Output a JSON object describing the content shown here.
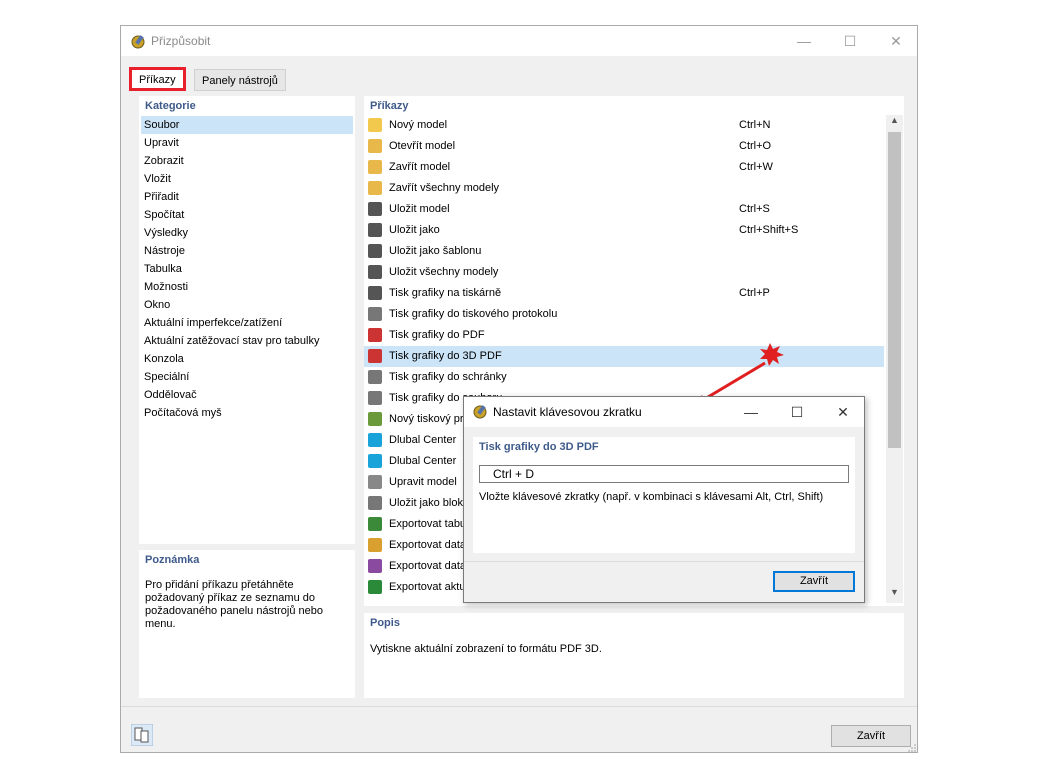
{
  "window": {
    "title": "Přizpůsobit",
    "min": "—",
    "max": "☐",
    "close": "✕"
  },
  "tabs": [
    {
      "label": "Příkazy"
    },
    {
      "label": "Panely nástrojů"
    }
  ],
  "categories": {
    "header": "Kategorie",
    "items": [
      {
        "label": "Soubor"
      },
      {
        "label": "Upravit"
      },
      {
        "label": "Zobrazit"
      },
      {
        "label": "Vložit"
      },
      {
        "label": "Přiřadit"
      },
      {
        "label": "Spočítat"
      },
      {
        "label": "Výsledky"
      },
      {
        "label": "Nástroje"
      },
      {
        "label": "Tabulka"
      },
      {
        "label": "Možnosti"
      },
      {
        "label": "Okno"
      },
      {
        "label": "Aktuální imperfekce/zatížení"
      },
      {
        "label": "Aktuální zatěžovací stav pro tabulky"
      },
      {
        "label": "Konzola"
      },
      {
        "label": "Speciální"
      },
      {
        "label": "Oddělovač"
      },
      {
        "label": "Počítačová myš"
      }
    ]
  },
  "note": {
    "header": "Poznámka",
    "text": "Pro přidání příkazu přetáhněte požadovaný příkaz ze seznamu do požadovaného panelu nástrojů nebo menu."
  },
  "commands": {
    "header": "Příkazy",
    "items": [
      {
        "label": "Nový model",
        "key": "Ctrl+N",
        "icon": "new-model-icon"
      },
      {
        "label": "Otevřít model",
        "key": "Ctrl+O",
        "icon": "open-folder-icon"
      },
      {
        "label": "Zavřít model",
        "key": "Ctrl+W",
        "icon": "close-folder-icon"
      },
      {
        "label": "Zavřít všechny modely",
        "key": "",
        "icon": "close-all-folders-icon"
      },
      {
        "label": "Uložit model",
        "key": "Ctrl+S",
        "icon": "save-icon"
      },
      {
        "label": "Uložit jako",
        "key": "Ctrl+Shift+S",
        "icon": "save-as-icon"
      },
      {
        "label": "Uložit jako šablonu",
        "key": "",
        "icon": "save-template-icon"
      },
      {
        "label": "Uložit všechny modely",
        "key": "",
        "icon": "save-all-icon"
      },
      {
        "label": "Tisk grafiky na tiskárně",
        "key": "Ctrl+P",
        "icon": "printer-icon"
      },
      {
        "label": "Tisk grafiky do tiskového protokolu",
        "key": "",
        "icon": "print-report-icon"
      },
      {
        "label": "Tisk grafiky do PDF",
        "key": "",
        "icon": "print-pdf-icon"
      },
      {
        "label": "Tisk grafiky do 3D PDF",
        "key": "",
        "icon": "print-3d-pdf-icon"
      },
      {
        "label": "Tisk grafiky do schránky",
        "key": "",
        "icon": "print-clipboard-icon"
      },
      {
        "label": "Tisk grafiky do souboru",
        "key": "",
        "icon": "print-file-icon"
      },
      {
        "label": "Nový tiskový protokol",
        "key": "",
        "icon": "new-report-icon"
      },
      {
        "label": "Dlubal Center",
        "key": "",
        "icon": "dlubal-center-icon"
      },
      {
        "label": "Dlubal Center",
        "key": "",
        "icon": "dlubal-center-settings-icon"
      },
      {
        "label": "Upravit model",
        "key": "",
        "icon": "edit-model-icon"
      },
      {
        "label": "Uložit jako blok",
        "key": "",
        "icon": "save-block-icon"
      },
      {
        "label": "Exportovat tabulky",
        "key": "",
        "icon": "export-table-icon"
      },
      {
        "label": "Exportovat data",
        "key": "",
        "icon": "export-data-icon"
      },
      {
        "label": "Exportovat data",
        "key": "",
        "icon": "export-data-2-icon"
      },
      {
        "label": "Exportovat aktuální",
        "key": "",
        "icon": "export-sap-icon"
      }
    ]
  },
  "description": {
    "header": "Popis",
    "text": "Vytiskne aktuální zobrazení to formátu PDF 3D."
  },
  "footer": {
    "close_label": "Zavřít"
  },
  "shortcut_dialog": {
    "title": "Nastavit klávesovou zkratku",
    "command": "Tisk grafiky do 3D PDF",
    "input_value": "Ctrl + D",
    "hint": "Vložte klávesové zkratky (např. v kombinaci s klávesami Alt, Ctrl, Shift)",
    "close_label": "Zavřít",
    "min": "—",
    "max": "☐",
    "close": "✕"
  },
  "colors": {
    "highlight": "#cce4f7",
    "tab_marker": "#e8202c",
    "arrow": "#e02020",
    "header_text": "#3e5a8a"
  }
}
